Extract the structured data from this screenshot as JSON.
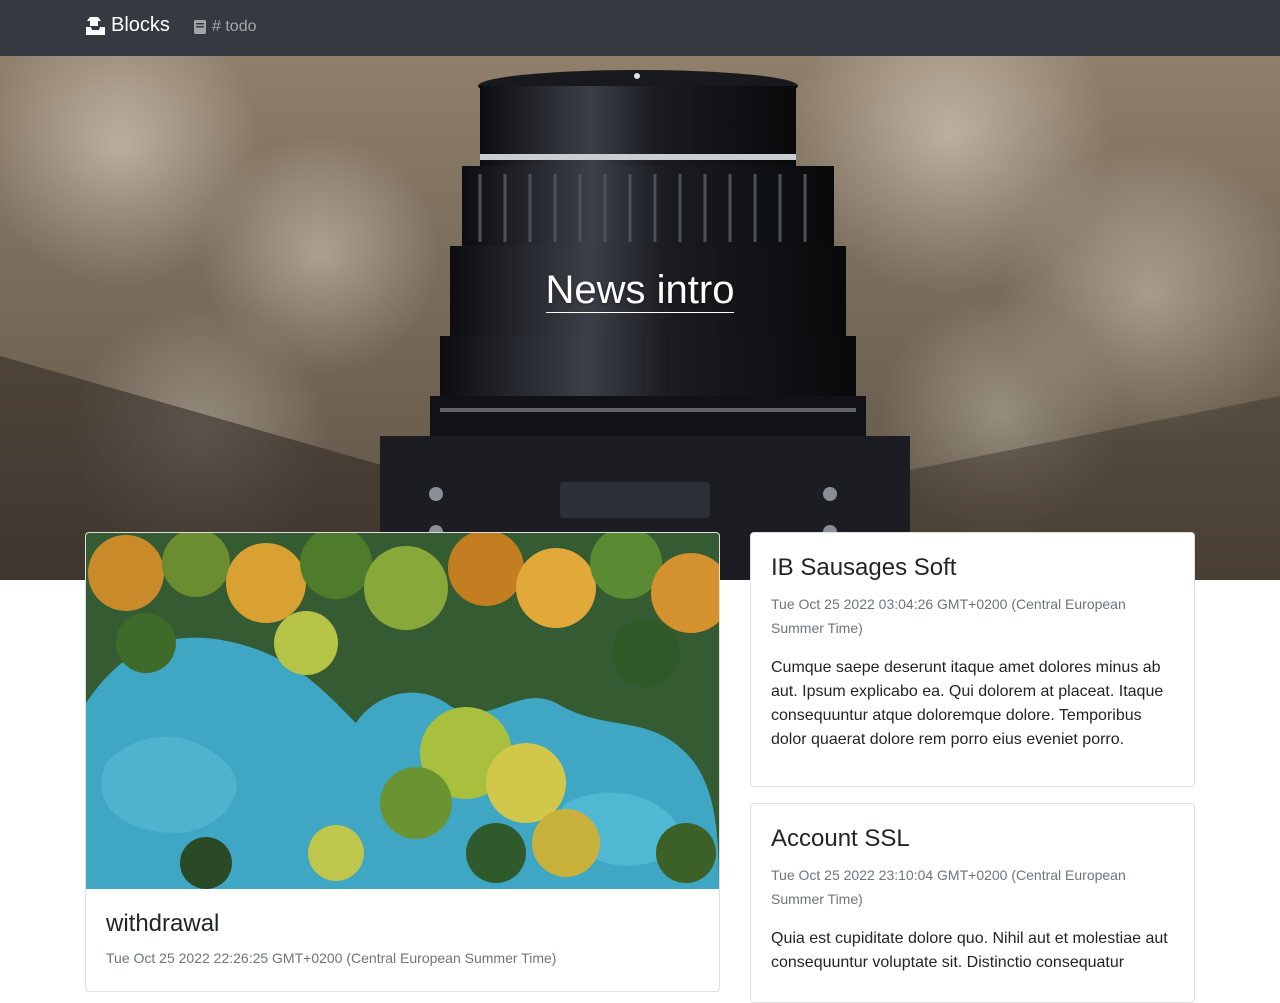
{
  "navbar": {
    "brand_label": "Blocks",
    "brand_icon": "inbox-tray-icon",
    "todo_label": "# todo",
    "todo_icon": "book-icon"
  },
  "hero": {
    "title": "News intro",
    "image": "camera-lens-photo"
  },
  "cards": [
    {
      "title": "withdrawal",
      "date": "Tue Oct 25 2022 22:26:25 GMT+0200 (Central European Summer Time)",
      "image": "aerial-forest-lake-photo"
    },
    {
      "title": "IB Sausages Soft",
      "date": "Tue Oct 25 2022 03:04:26 GMT+0200 (Central European Summer Time)",
      "text": "Cumque saepe deserunt itaque amet dolores minus ab aut. Ipsum explicabo ea. Qui dolorem at placeat. Itaque consequuntur atque doloremque dolore. Temporibus dolor quaerat dolore rem porro eius eveniet porro."
    },
    {
      "title": "Account SSL",
      "date": "Tue Oct 25 2022 23:10:04 GMT+0200 (Central European Summer Time)",
      "text": "Quia est cupiditate dolore quo. Nihil aut et molestiae aut consequuntur voluptate sit. Distinctio consequatur"
    }
  ],
  "colors": {
    "navbar_bg": "#343a40",
    "muted_text": "#6c757d"
  }
}
